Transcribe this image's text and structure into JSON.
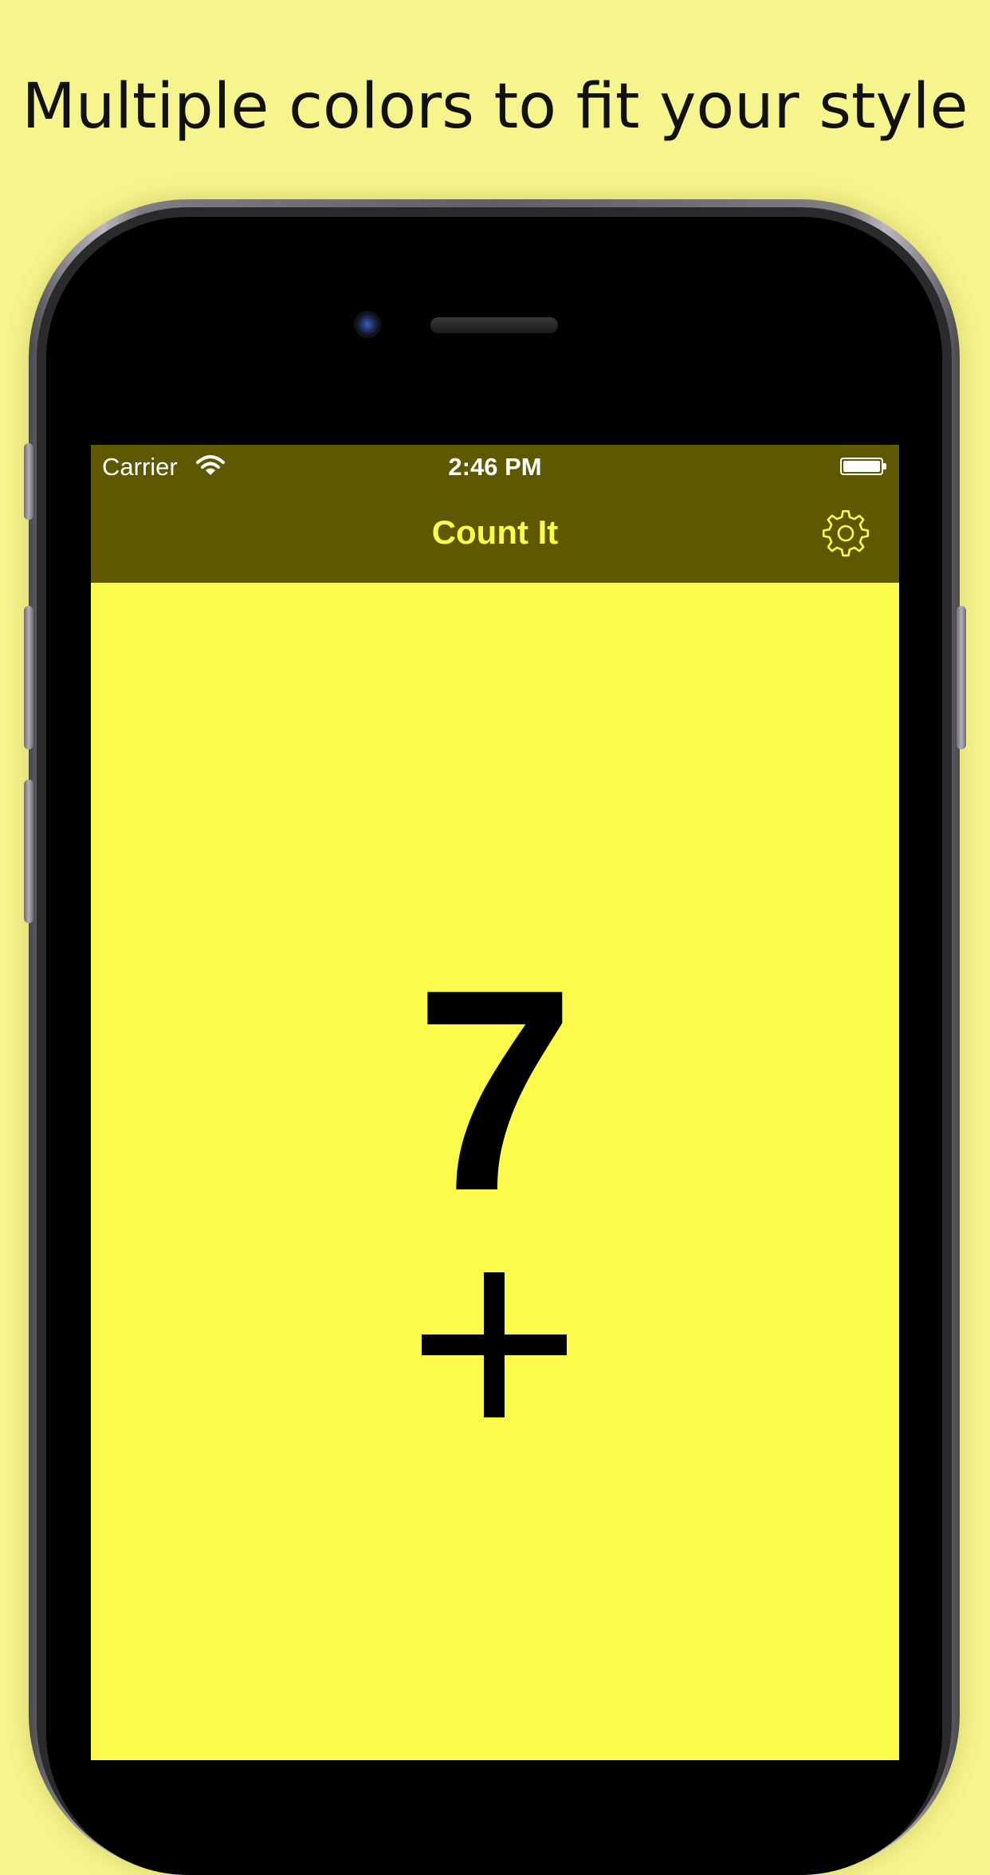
{
  "headline": "Multiple colors to fit your style",
  "status_bar": {
    "carrier": "Carrier",
    "time": "2:46 PM",
    "wifi_icon": "wifi-icon",
    "battery_icon": "battery-icon",
    "battery_level": 1.0
  },
  "nav": {
    "title": "Count It",
    "settings_icon": "gear-icon"
  },
  "counter": {
    "value": "7",
    "increment_icon": "plus-icon"
  },
  "colors": {
    "page_background": "#f6f48c",
    "screen_background": "#fcfa4a",
    "nav_background": "#5e5900",
    "accent": "#fcfa4a",
    "text": "#000000"
  }
}
